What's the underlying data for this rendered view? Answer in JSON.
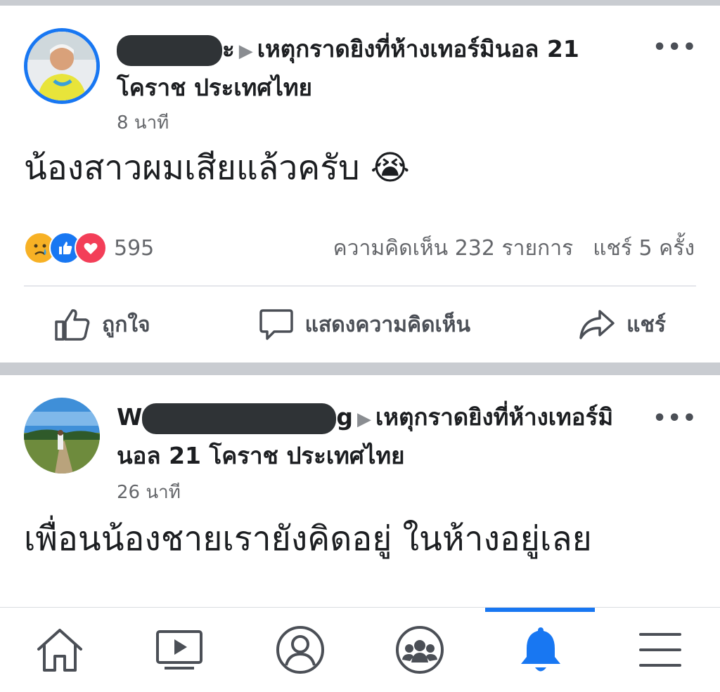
{
  "posts": [
    {
      "author_visible_suffix": "ะ",
      "group": "เหตุกราดยิงที่ห้างเทอร์มินอล 21 โคราช ประเทศไทย",
      "time": "8 นาที",
      "text": "น้องสาวผมเสียแล้วครับ 😭",
      "reaction_count": "595",
      "comments": "ความคิดเห็น 232 รายการ",
      "shares": "แชร์ 5 ครั้ง"
    },
    {
      "author_prefix": "W",
      "author_suffix": "g",
      "group": "เหตุกราดยิงที่ห้างเทอร์มินอล 21 โคราช ประเทศไทย",
      "time": "26 นาที",
      "text": "เพื่อนน้องชายเรายังคิดอยู่ ในห้างอยู่เลย"
    }
  ],
  "actions": {
    "like": "ถูกใจ",
    "comment": "แสดงความคิดเห็น",
    "share": "แชร์"
  },
  "more_icon": "•••",
  "nav": [
    "home-icon",
    "video-icon",
    "profile-icon",
    "groups-icon",
    "notifications-icon",
    "menu-icon"
  ],
  "colors": {
    "accent": "#1877f2",
    "separator": "#c9ccd1",
    "love": "#f33e58",
    "sad": "#f7b125"
  }
}
